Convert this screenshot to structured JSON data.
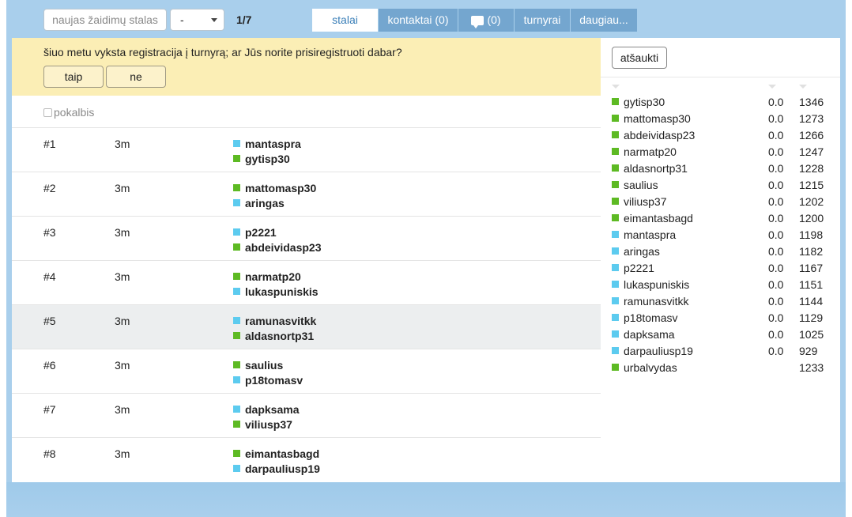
{
  "topbar": {
    "new_table_label": "naujas žaidimų stalas",
    "select_value": "-",
    "counter": "1/7",
    "tabs": [
      {
        "label": "stalai",
        "active": true
      },
      {
        "label": "kontaktai (0)",
        "active": false
      },
      {
        "label": "(0)",
        "active": false,
        "icon": "chat-icon"
      },
      {
        "label": "turnyrai",
        "active": false
      },
      {
        "label": "daugiau...",
        "active": false
      }
    ]
  },
  "notice": {
    "message": "šiuo metu vyksta registracija į turnyrą; ar Jūs norite prisiregistruoti dabar?",
    "yes_label": "taip",
    "no_label": "ne"
  },
  "chat_toggle_label": "pokalbis",
  "tables": [
    {
      "num": "#1",
      "time": "3m",
      "players": [
        {
          "name": "mantaspra",
          "color": "blue"
        },
        {
          "name": "gytisp30",
          "color": "green"
        }
      ]
    },
    {
      "num": "#2",
      "time": "3m",
      "players": [
        {
          "name": "mattomasp30",
          "color": "green"
        },
        {
          "name": "aringas",
          "color": "blue"
        }
      ]
    },
    {
      "num": "#3",
      "time": "3m",
      "players": [
        {
          "name": "p2221",
          "color": "blue"
        },
        {
          "name": "abdeividasp23",
          "color": "green"
        }
      ]
    },
    {
      "num": "#4",
      "time": "3m",
      "players": [
        {
          "name": "narmatp20",
          "color": "green"
        },
        {
          "name": "lukaspuniskis",
          "color": "blue"
        }
      ]
    },
    {
      "num": "#5",
      "time": "3m",
      "highlight": true,
      "players": [
        {
          "name": "ramunasvitkk",
          "color": "blue"
        },
        {
          "name": "aldasnortp31",
          "color": "green"
        }
      ]
    },
    {
      "num": "#6",
      "time": "3m",
      "players": [
        {
          "name": "saulius",
          "color": "green"
        },
        {
          "name": "p18tomasv",
          "color": "blue"
        }
      ]
    },
    {
      "num": "#7",
      "time": "3m",
      "players": [
        {
          "name": "dapksama",
          "color": "blue"
        },
        {
          "name": "viliusp37",
          "color": "green"
        }
      ]
    },
    {
      "num": "#8",
      "time": "3m",
      "players": [
        {
          "name": "eimantasbagd",
          "color": "green"
        },
        {
          "name": "darpauliusp19",
          "color": "blue"
        }
      ]
    }
  ],
  "right_panel": {
    "cancel_label": "atšaukti",
    "players": [
      {
        "name": "gytisp30",
        "score": "0.0",
        "rating": "1346",
        "color": "green"
      },
      {
        "name": "mattomasp30",
        "score": "0.0",
        "rating": "1273",
        "color": "green"
      },
      {
        "name": "abdeividasp23",
        "score": "0.0",
        "rating": "1266",
        "color": "green"
      },
      {
        "name": "narmatp20",
        "score": "0.0",
        "rating": "1247",
        "color": "green"
      },
      {
        "name": "aldasnortp31",
        "score": "0.0",
        "rating": "1228",
        "color": "green"
      },
      {
        "name": "saulius",
        "score": "0.0",
        "rating": "1215",
        "color": "green"
      },
      {
        "name": "viliusp37",
        "score": "0.0",
        "rating": "1202",
        "color": "green"
      },
      {
        "name": "eimantasbagd",
        "score": "0.0",
        "rating": "1200",
        "color": "green"
      },
      {
        "name": "mantaspra",
        "score": "0.0",
        "rating": "1198",
        "color": "blue"
      },
      {
        "name": "aringas",
        "score": "0.0",
        "rating": "1182",
        "color": "blue"
      },
      {
        "name": "p2221",
        "score": "0.0",
        "rating": "1167",
        "color": "blue"
      },
      {
        "name": "lukaspuniskis",
        "score": "0.0",
        "rating": "1151",
        "color": "blue"
      },
      {
        "name": "ramunasvitkk",
        "score": "0.0",
        "rating": "1144",
        "color": "blue"
      },
      {
        "name": "p18tomasv",
        "score": "0.0",
        "rating": "1129",
        "color": "blue"
      },
      {
        "name": "dapksama",
        "score": "0.0",
        "rating": "1025",
        "color": "blue"
      },
      {
        "name": "darpauliusp19",
        "score": "0.0",
        "rating": "929",
        "color": "blue"
      },
      {
        "name": "urbalvydas",
        "score": "",
        "rating": "1233",
        "color": "green"
      }
    ]
  },
  "colors": {
    "green": "#5dba23",
    "blue": "#5ccbef",
    "notice_bg": "#fbeeb5",
    "frame": "#a9cfec"
  }
}
